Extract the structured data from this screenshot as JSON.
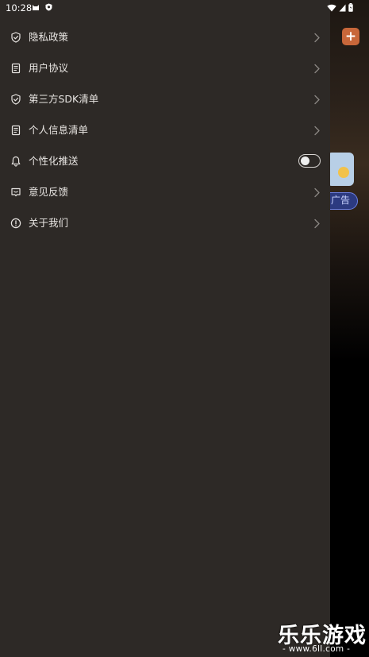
{
  "status_bar": {
    "time": "10:28"
  },
  "background_app": {
    "ad_pill_label": "广告",
    "add_button_label": "+"
  },
  "menu": {
    "items": [
      {
        "label": "隐私政策",
        "icon": "shield-check-icon",
        "trailing": "chevron"
      },
      {
        "label": "用户协议",
        "icon": "document-icon",
        "trailing": "chevron"
      },
      {
        "label": "第三方SDK清单",
        "icon": "shield-check-icon",
        "trailing": "chevron"
      },
      {
        "label": "个人信息清单",
        "icon": "document-icon",
        "trailing": "chevron"
      },
      {
        "label": "个性化推送",
        "icon": "bell-icon",
        "trailing": "toggle",
        "toggle_on": false
      },
      {
        "label": "意见反馈",
        "icon": "feedback-icon",
        "trailing": "chevron"
      },
      {
        "label": "关于我们",
        "icon": "info-icon",
        "trailing": "chevron"
      }
    ]
  },
  "watermark": {
    "title": "乐乐游戏",
    "url": "- www.6ll.com -"
  },
  "colors": {
    "drawer_bg": "#2d2926",
    "text": "#e9e6e3",
    "accent_orange": "#c8673a"
  }
}
